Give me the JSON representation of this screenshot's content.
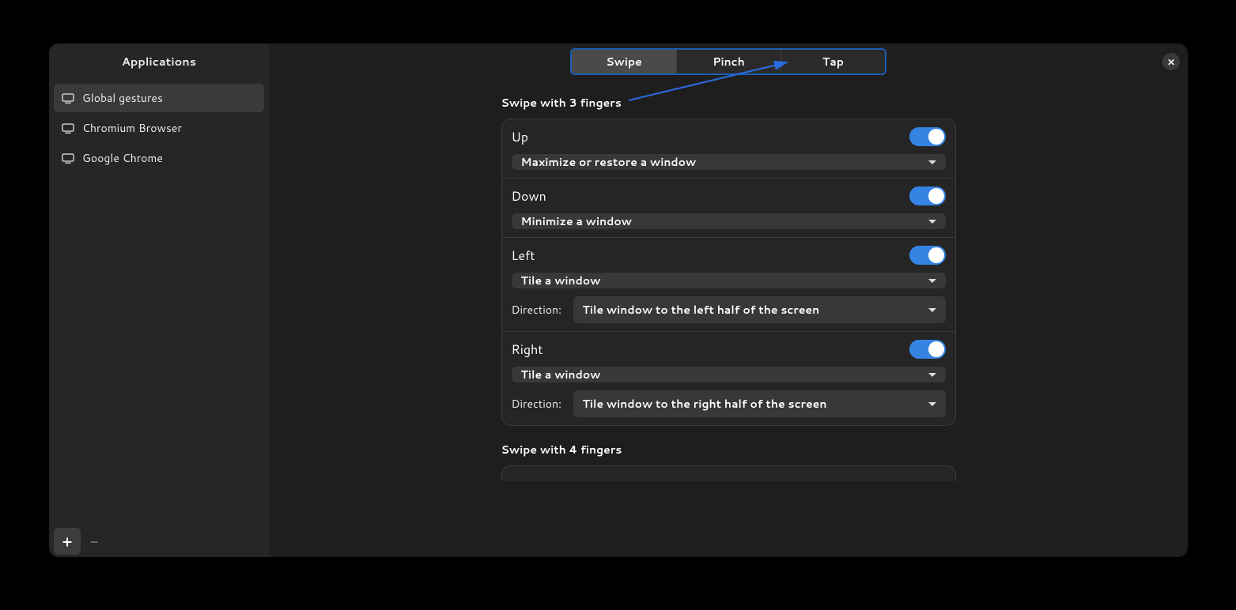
{
  "sidebar": {
    "title": "Applications",
    "items": [
      {
        "label": "Global gestures",
        "active": true
      },
      {
        "label": "Chromium Browser",
        "active": false
      },
      {
        "label": "Google Chrome",
        "active": false
      }
    ],
    "add_label": "+",
    "remove_label": "−"
  },
  "tabs": [
    {
      "label": "Swipe",
      "active": true
    },
    {
      "label": "Pinch",
      "active": false
    },
    {
      "label": "Tap",
      "active": false
    }
  ],
  "close_label": "✕",
  "sections": {
    "swipe3": {
      "title": "Swipe with 3 fingers",
      "rows": [
        {
          "label": "Up",
          "enabled": true,
          "action": "Maximize or restore a window"
        },
        {
          "label": "Down",
          "enabled": true,
          "action": "Minimize a window"
        },
        {
          "label": "Left",
          "enabled": true,
          "action": "Tile a window",
          "direction_label": "Direction:",
          "direction": "Tile window to the left half of the screen"
        },
        {
          "label": "Right",
          "enabled": true,
          "action": "Tile a window",
          "direction_label": "Direction:",
          "direction": "Tile window to the right half of the screen"
        }
      ]
    },
    "swipe4": {
      "title": "Swipe with 4 fingers"
    }
  }
}
